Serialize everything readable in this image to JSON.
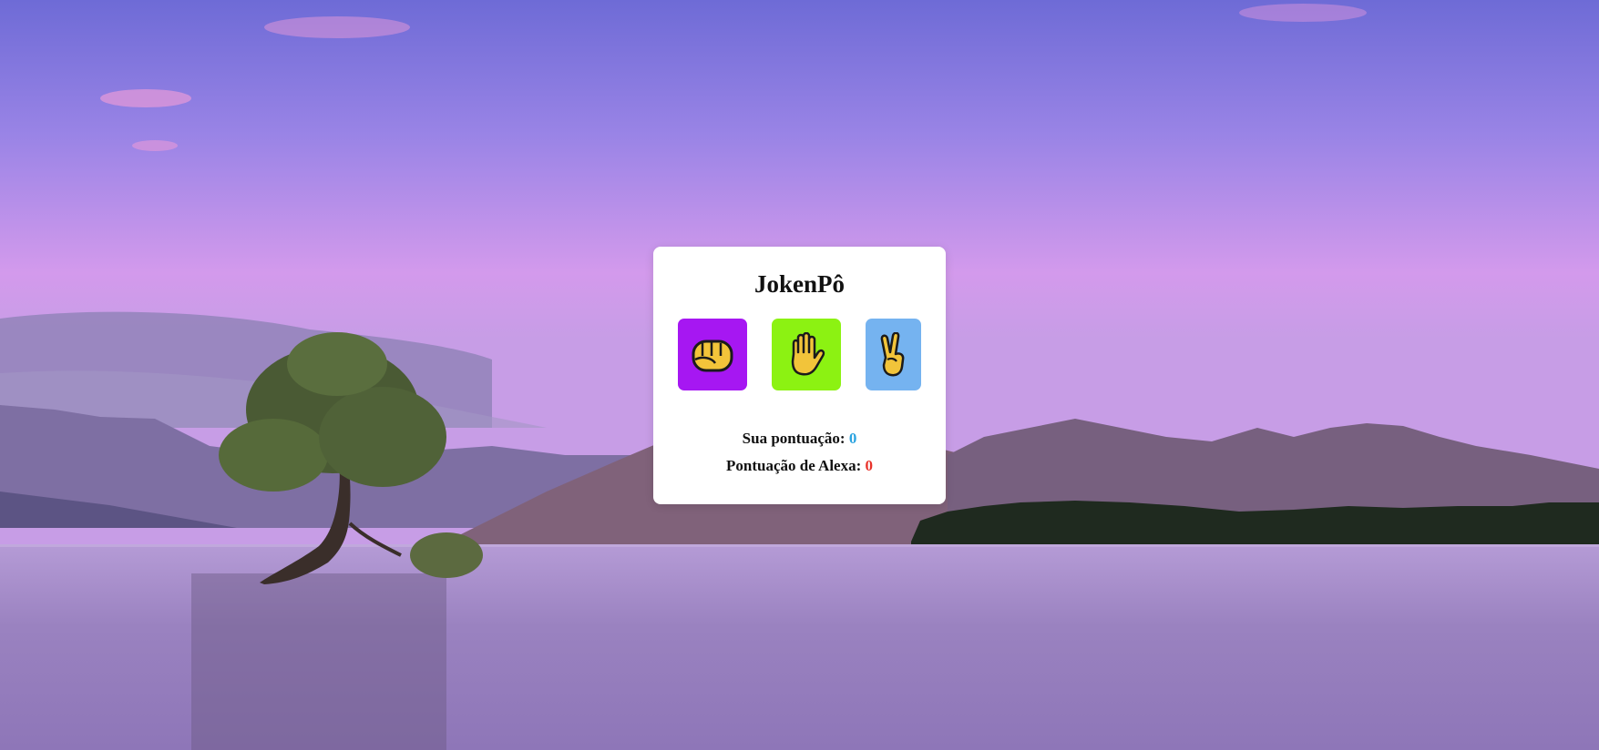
{
  "game": {
    "title": "JokenPô",
    "choices": [
      {
        "name": "rock",
        "icon": "fist-icon",
        "bg_color": "#a617f2"
      },
      {
        "name": "paper",
        "icon": "raised-hand-icon",
        "bg_color": "#8cf212"
      },
      {
        "name": "scissors",
        "icon": "victory-hand-icon",
        "bg_color": "#75b3f0"
      }
    ],
    "score": {
      "user_label": "Sua pontuação:",
      "user_value": "0",
      "alexa_label": "Pontuação de Alexa:",
      "alexa_value": "0"
    }
  },
  "colors": {
    "user_score": "#2aa3e0",
    "alexa_score": "#e8322a",
    "card": "#ffffff"
  },
  "background": {
    "scene": "purple sky over mountains and lake with a lone tree"
  }
}
